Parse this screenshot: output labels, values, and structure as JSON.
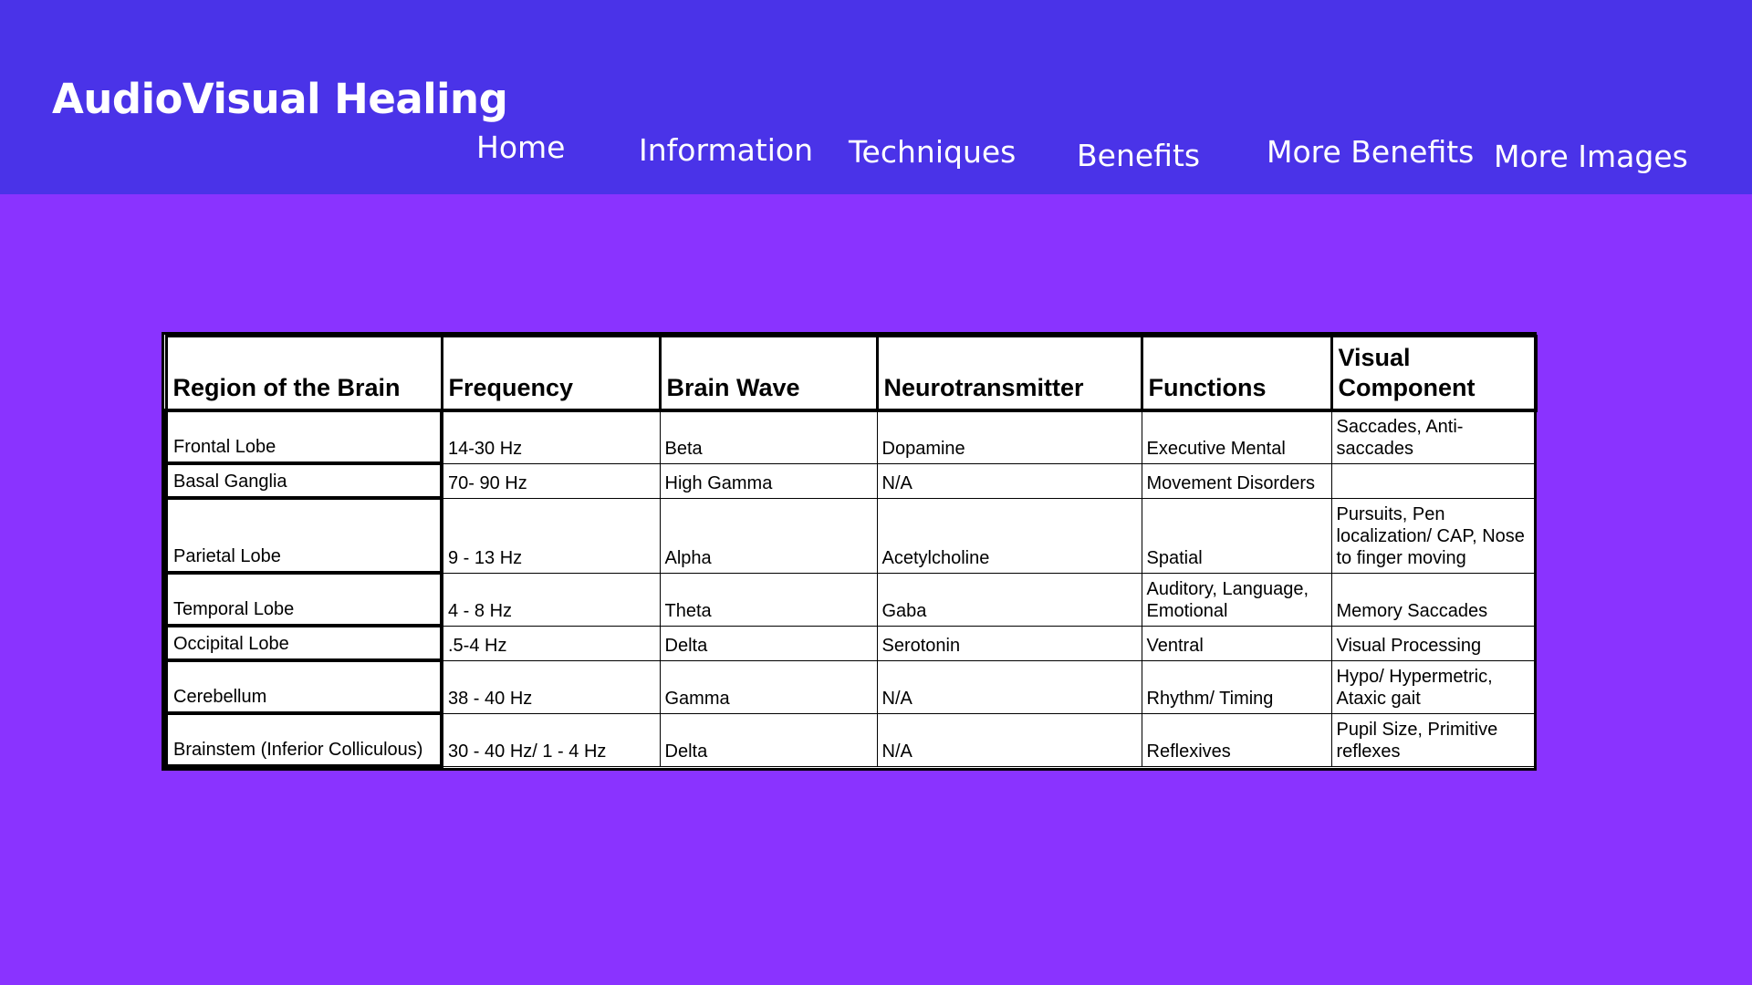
{
  "header": {
    "site_title": "AudioVisual Healing",
    "nav": [
      "Home",
      "Information",
      "Techniques",
      "Benefits",
      "More Benefits",
      "More Images"
    ]
  },
  "colors": {
    "header_background": "#4a33e8",
    "page_background": "#8a33ff",
    "table_background": "#ffffff",
    "text_light": "#ffffff",
    "text_dark": "#000000"
  },
  "table": {
    "columns": [
      "Region of the Brain",
      "Frequency",
      "Brain Wave",
      "Neurotransmitter",
      "Functions",
      "Visual Component"
    ],
    "rows": [
      [
        "Frontal Lobe",
        "14-30 Hz",
        "Beta",
        "Dopamine",
        "Executive Mental",
        "Saccades, Anti-saccades"
      ],
      [
        "Basal Ganglia",
        "70- 90 Hz",
        "High Gamma",
        "N/A",
        "Movement Disorders",
        ""
      ],
      [
        "Parietal Lobe",
        "9 - 13 Hz",
        "Alpha",
        "Acetylcholine",
        "Spatial",
        "Pursuits, Pen localization/ CAP, Nose to finger moving"
      ],
      [
        "Temporal Lobe",
        "4 - 8 Hz",
        "Theta",
        "Gaba",
        "Auditory, Language, Emotional",
        "Memory Saccades"
      ],
      [
        "Occipital Lobe",
        ".5-4 Hz",
        "Delta",
        "Serotonin",
        "Ventral",
        "Visual Processing"
      ],
      [
        "Cerebellum",
        "38 - 40 Hz",
        "Gamma",
        "N/A",
        "Rhythm/ Timing",
        "Hypo/ Hypermetric, Ataxic gait"
      ],
      [
        "Brainstem (Inferior Colliculous)",
        "30 - 40 Hz/ 1 - 4 Hz",
        "Delta",
        "N/A",
        "Reflexives",
        "Pupil Size, Primitive reflexes"
      ]
    ]
  }
}
